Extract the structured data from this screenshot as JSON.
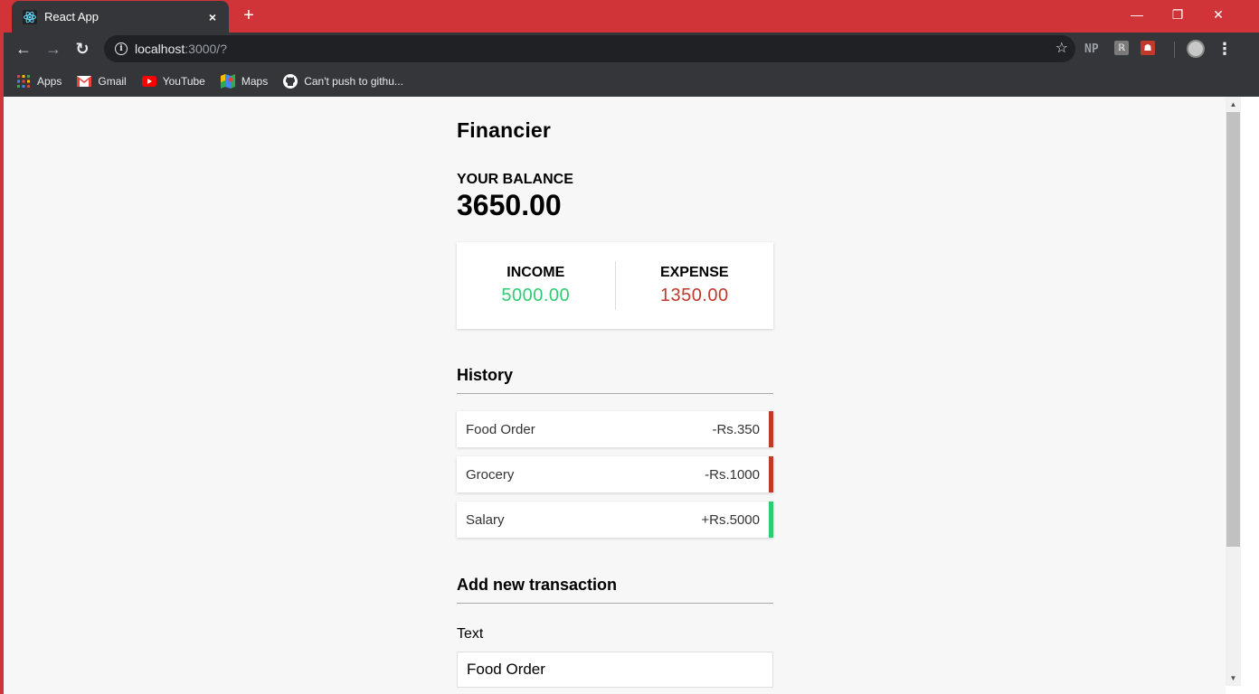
{
  "browser": {
    "tab_title": "React App",
    "tab_close": "×",
    "new_tab": "+",
    "window": {
      "minimize": "—",
      "restore": "❐",
      "close": "✕"
    },
    "nav": {
      "back": "←",
      "forward": "→",
      "reload": "↻"
    },
    "url_host": "localhost",
    "url_path": ":3000/?",
    "bookmark_star": "☆",
    "extension_np": "NP",
    "menu": "⋮",
    "bookmarks": [
      {
        "label": "Apps",
        "icon": "apps-grid-icon"
      },
      {
        "label": "Gmail",
        "icon": "gmail-icon"
      },
      {
        "label": "YouTube",
        "icon": "youtube-icon"
      },
      {
        "label": "Maps",
        "icon": "maps-icon"
      },
      {
        "label": "Can't push to githu...",
        "icon": "github-icon"
      }
    ]
  },
  "app": {
    "title": "Financier",
    "balance_label": "YOUR BALANCE",
    "balance_value": "3650.00",
    "income_label": "INCOME",
    "income_value": "5000.00",
    "expense_label": "EXPENSE",
    "expense_value": "1350.00",
    "history_title": "History",
    "transactions": [
      {
        "text": "Food Order",
        "amount": "-Rs.350",
        "type": "minus"
      },
      {
        "text": "Grocery",
        "amount": "-Rs.1000",
        "type": "minus"
      },
      {
        "text": "Salary",
        "amount": "+Rs.5000",
        "type": "plus"
      }
    ],
    "add_title": "Add new transaction",
    "text_label": "Text",
    "text_value": "Food Order"
  },
  "colors": {
    "titlebar": "#d13438",
    "income": "#2ecc71",
    "expense": "#c0392b"
  }
}
